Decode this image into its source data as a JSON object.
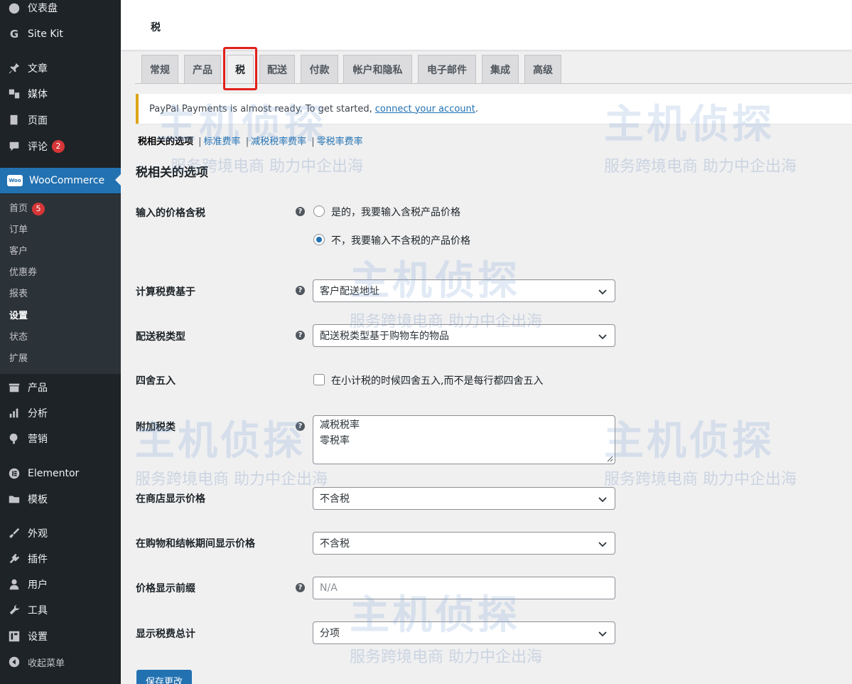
{
  "sidebar": {
    "items": [
      {
        "label": "仪表盘",
        "icon": "dashboard-icon"
      },
      {
        "label": "Site Kit",
        "icon": "site-kit-icon"
      },
      {
        "label": "文章",
        "icon": "pin-icon"
      },
      {
        "label": "媒体",
        "icon": "media-icon"
      },
      {
        "label": "页面",
        "icon": "page-icon"
      },
      {
        "label": "评论",
        "icon": "comment-icon",
        "badge": "2"
      },
      {
        "label": "WooCommerce",
        "icon": "woo-icon",
        "logo_text": "Woo"
      },
      {
        "label": "产品",
        "icon": "product-icon"
      },
      {
        "label": "分析",
        "icon": "analytics-icon"
      },
      {
        "label": "营销",
        "icon": "marketing-icon"
      },
      {
        "label": "Elementor",
        "icon": "elementor-icon"
      },
      {
        "label": "模板",
        "icon": "folder-icon"
      },
      {
        "label": "外观",
        "icon": "brush-icon"
      },
      {
        "label": "插件",
        "icon": "plugin-icon"
      },
      {
        "label": "用户",
        "icon": "user-icon"
      },
      {
        "label": "工具",
        "icon": "wrench-icon"
      },
      {
        "label": "设置",
        "icon": "settings-icon"
      },
      {
        "label": "收起菜单",
        "icon": "collapse-icon"
      }
    ],
    "submenu": [
      {
        "label": "首页",
        "badge": "5"
      },
      {
        "label": "订单"
      },
      {
        "label": "客户"
      },
      {
        "label": "优惠券"
      },
      {
        "label": "报表"
      },
      {
        "label": "设置",
        "current": true
      },
      {
        "label": "状态"
      },
      {
        "label": "扩展"
      }
    ]
  },
  "topbar": {
    "title": "税"
  },
  "tabs": [
    {
      "label": "常规"
    },
    {
      "label": "产品"
    },
    {
      "label": "税",
      "active": true
    },
    {
      "label": "配送"
    },
    {
      "label": "付款"
    },
    {
      "label": "帐户和隐私"
    },
    {
      "label": "电子邮件"
    },
    {
      "label": "集成"
    },
    {
      "label": "高级"
    }
  ],
  "notice": {
    "text": "PayPal Payments is almost ready. To get started,",
    "link": "connect your account",
    "suffix": "."
  },
  "subsubsub": {
    "current": "税相关的选项",
    "links": [
      "标准费率",
      "减税税率费率",
      "零税率费率"
    ],
    "separator": "|"
  },
  "section_title": "税相关的选项",
  "form": {
    "prices_include_tax": {
      "label": "输入的价格含税",
      "option_yes": "是的，我要输入含税产品价格",
      "option_no": "不，我要输入不含税的产品价格",
      "selected": "no"
    },
    "tax_based_on": {
      "label": "计算税费基于",
      "value": "客户配送地址"
    },
    "shipping_tax_class": {
      "label": "配送税类型",
      "value": "配送税类型基于购物车的物品"
    },
    "rounding": {
      "label": "四舍五入",
      "option": "在小计税的时候四舍五入,而不是每行都四舍五入",
      "checked": false
    },
    "additional_tax_classes": {
      "label": "附加税类",
      "line1": "减税税率",
      "line2": "零税率"
    },
    "display_shop": {
      "label": "在商店显示价格",
      "value": "不含税"
    },
    "display_cart": {
      "label": "在购物和结帐期间显示价格",
      "value": "不含税"
    },
    "price_suffix": {
      "label": "价格显示前缀",
      "placeholder": "N/A"
    },
    "display_totals": {
      "label": "显示税费总计",
      "value": "分项"
    }
  },
  "help_glyph": "?",
  "save_button": "保存更改",
  "watermark": {
    "brand": "主机侦探",
    "tagline": "服务跨境电商 助力中企出海"
  },
  "colors": {
    "sidebar": "#1d2327",
    "accent": "#2271b1",
    "badge": "#d63638",
    "highlight": "#e0201b",
    "notice_border": "#dba617"
  }
}
